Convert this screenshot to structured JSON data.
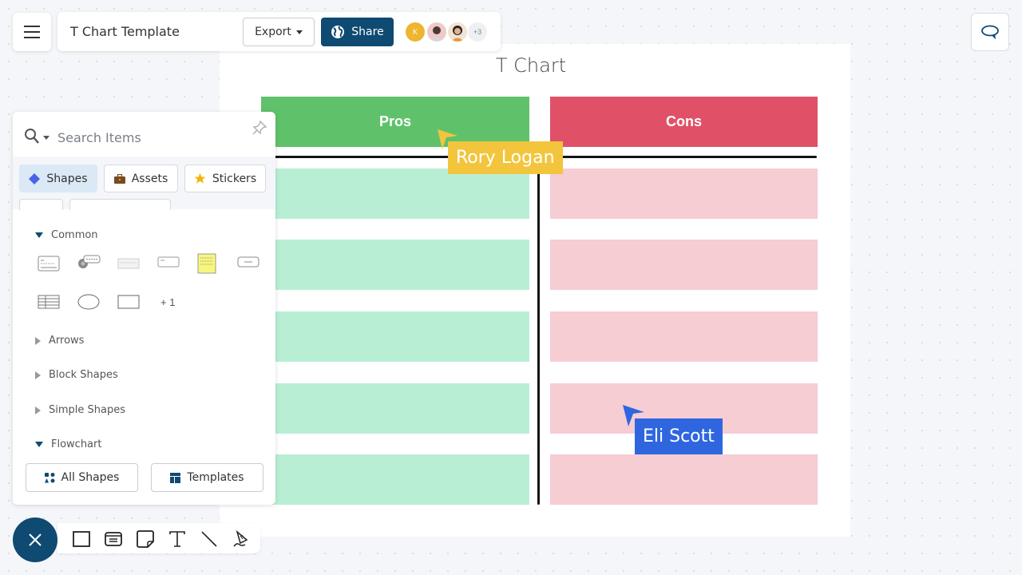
{
  "header": {
    "document_title": "T Chart Template",
    "export_label": "Export",
    "share_label": "Share",
    "collaborators": [
      {
        "initial": "K",
        "color": "#eeb530"
      },
      {
        "initial": "",
        "color": "#f0c9c9"
      },
      {
        "initial": "",
        "color": "#efe4d6"
      }
    ],
    "more_collaborators": "+3"
  },
  "shape_panel": {
    "search_placeholder": "Search Items",
    "tabs": [
      {
        "label": "Shapes",
        "icon": "diamond-icon",
        "active": true
      },
      {
        "label": "Assets",
        "icon": "briefcase-icon",
        "active": false
      },
      {
        "label": "Stickers",
        "icon": "star-icon",
        "active": false
      }
    ],
    "sections": [
      {
        "label": "Common",
        "expanded": true
      },
      {
        "label": "Arrows",
        "expanded": false
      },
      {
        "label": "Block Shapes",
        "expanded": false
      },
      {
        "label": "Simple Shapes",
        "expanded": false
      },
      {
        "label": "Flowchart",
        "expanded": true
      }
    ],
    "common_shapes": [
      "card-shape",
      "comment-shape",
      "text-block-shape",
      "label-shape",
      "sticky-note-shape",
      "button-shape",
      "table-shape",
      "ellipse-shape",
      "rectangle-shape"
    ],
    "more_count": "+ 1",
    "footer_buttons": {
      "all_shapes": "All Shapes",
      "templates": "Templates"
    }
  },
  "canvas": {
    "title": "T Chart",
    "columns": [
      {
        "header": "Pros",
        "color": "#5fc26b",
        "cell_color": "#b8efd4",
        "rows": [
          "",
          "",
          "",
          "",
          ""
        ]
      },
      {
        "header": "Cons",
        "color": "#e05167",
        "cell_color": "#f5cdd3",
        "rows": [
          "",
          "",
          "",
          "",
          ""
        ]
      }
    ]
  },
  "cursors": [
    {
      "name": "Rory Logan",
      "color": "#f2c53d"
    },
    {
      "name": "Eli Scott",
      "color": "#2f66e0"
    }
  ],
  "bottom_toolbar": {
    "tools": [
      "rectangle-tool",
      "card-tool",
      "sticky-note-tool",
      "text-tool",
      "line-tool",
      "pen-tool"
    ]
  }
}
